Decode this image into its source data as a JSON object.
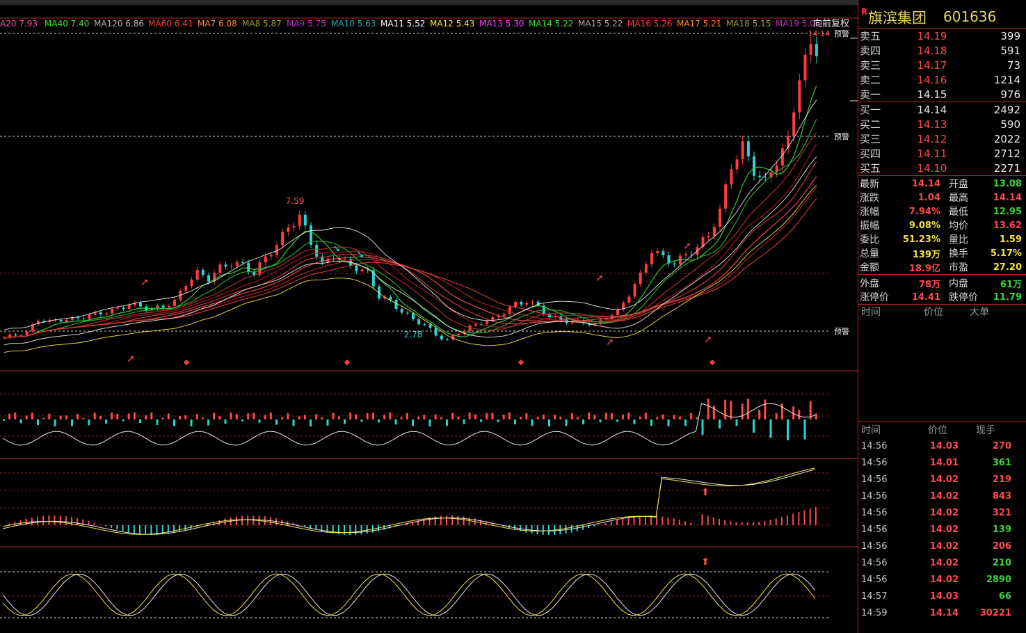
{
  "chart": {
    "ma_legend": [
      {
        "label": "A20 7.93",
        "color": "#ff4fa8"
      },
      {
        "label": "MA40 7.40",
        "color": "#39e23a"
      },
      {
        "label": "MA120 6.86",
        "color": "#b5b5b5"
      },
      {
        "label": "MA60 6.41",
        "color": "#ff3c3c"
      },
      {
        "label": "MA7 6.08",
        "color": "#ff8c2e"
      },
      {
        "label": "MA8 5.87",
        "color": "#9a9a3a"
      },
      {
        "label": "MA9 5.75",
        "color": "#c030c0"
      },
      {
        "label": "MA10 5.63",
        "color": "#2aa6a6"
      },
      {
        "label": "MA11 5.52",
        "color": "#ffffff"
      },
      {
        "label": "MA12 5.43",
        "color": "#f4e542"
      },
      {
        "label": "MA13 5.30",
        "color": "#ff3cff"
      },
      {
        "label": "MA14 5.22",
        "color": "#39e23a"
      },
      {
        "label": "MA15 5.22",
        "color": "#a8a8a8"
      },
      {
        "label": "MA16 5.26",
        "color": "#ff3c3c"
      },
      {
        "label": "MA17 5.21",
        "color": "#ff8c2e"
      },
      {
        "label": "MA18 5.15",
        "color": "#9a9a3a"
      },
      {
        "label": "MA19 5.06",
        "color": "#c030c0"
      }
    ],
    "adjust_mode": "向前复权",
    "price_high_label": "14.14",
    "peak_label": "7.59",
    "trough_label": "2.78",
    "alert_labels": [
      "预警",
      "预警",
      "预警"
    ]
  },
  "stock": {
    "flag": "R",
    "name": "旗滨集团",
    "code": "601636"
  },
  "order_book": {
    "asks": [
      {
        "label": "卖五",
        "price": "14.19",
        "vol": "399"
      },
      {
        "label": "卖四",
        "price": "14.18",
        "vol": "591"
      },
      {
        "label": "卖三",
        "price": "14.17",
        "vol": "73"
      },
      {
        "label": "卖二",
        "price": "14.16",
        "vol": "1214"
      },
      {
        "label": "卖一",
        "price": "14.15",
        "vol": "976"
      }
    ],
    "bids": [
      {
        "label": "买一",
        "price": "14.14",
        "vol": "2492"
      },
      {
        "label": "买二",
        "price": "14.13",
        "vol": "590"
      },
      {
        "label": "买三",
        "price": "14.12",
        "vol": "2022"
      },
      {
        "label": "买四",
        "price": "14.11",
        "vol": "2712"
      },
      {
        "label": "买五",
        "price": "14.10",
        "vol": "2271"
      }
    ]
  },
  "stats": [
    {
      "k": "最新",
      "v": "14.14",
      "vc": "red",
      "k2": "开盘",
      "v2": "13.08",
      "v2c": "green"
    },
    {
      "k": "涨跌",
      "v": "1.04",
      "vc": "red",
      "k2": "最高",
      "v2": "14.14",
      "v2c": "red"
    },
    {
      "k": "涨幅",
      "v": "7.94%",
      "vc": "red",
      "k2": "最低",
      "v2": "12.95",
      "v2c": "green"
    },
    {
      "k": "振幅",
      "v": "9.08%",
      "vc": "yellow",
      "k2": "均价",
      "v2": "13.62",
      "v2c": "red"
    },
    {
      "k": "委比",
      "v": "51.23%",
      "vc": "yellow",
      "k2": "量比",
      "v2": "1.59",
      "v2c": "yellow"
    },
    {
      "k": "总量",
      "v": "139万",
      "vc": "yellow",
      "k2": "换手",
      "v2": "5.17%",
      "v2c": "yellow"
    },
    {
      "k": "金额",
      "v": "18.9亿",
      "vc": "red",
      "k2": "市盈",
      "v2": "27.20",
      "v2c": "yellow"
    }
  ],
  "ext": [
    {
      "k": "外盘",
      "v": "78万",
      "vc": "red",
      "k2": "内盘",
      "v2": "61万",
      "v2c": "green"
    },
    {
      "k": "涨停价",
      "v": "14.41",
      "vc": "red",
      "k2": "跌停价",
      "v2": "11.79",
      "v2c": "green"
    }
  ],
  "big_order_header": [
    "时间",
    "价位",
    "大单"
  ],
  "tick_header": [
    "时间",
    "价位",
    "现手"
  ],
  "ticks": [
    {
      "t": "14:56",
      "p": "14.03",
      "v": "270",
      "vc": "red"
    },
    {
      "t": "14:56",
      "p": "14.01",
      "v": "361",
      "vc": "green"
    },
    {
      "t": "14:56",
      "p": "14.02",
      "v": "219",
      "vc": "red"
    },
    {
      "t": "14:56",
      "p": "14.02",
      "v": "843",
      "vc": "red"
    },
    {
      "t": "14:56",
      "p": "14.02",
      "v": "321",
      "vc": "red"
    },
    {
      "t": "14:56",
      "p": "14.02",
      "v": "139",
      "vc": "green"
    },
    {
      "t": "14:56",
      "p": "14.02",
      "v": "206",
      "vc": "red"
    },
    {
      "t": "14:56",
      "p": "14.02",
      "v": "210",
      "vc": "green"
    },
    {
      "t": "14:56",
      "p": "14.02",
      "v": "2890",
      "vc": "green"
    },
    {
      "t": "14:57",
      "p": "14.03",
      "v": "66",
      "vc": "green"
    },
    {
      "t": "14:59",
      "p": "14.14",
      "v": "30221",
      "vc": "red"
    }
  ],
  "chart_data": {
    "type": "candlestick",
    "ylim": [
      2.5,
      14.6
    ],
    "closes": [
      2.9,
      3.0,
      3.1,
      3.6,
      3.5,
      3.6,
      3.6,
      3.7,
      3.8,
      3.9,
      4.0,
      4.2,
      4.1,
      4.0,
      4.1,
      4.3,
      5.0,
      5.4,
      5.2,
      5.6,
      5.8,
      5.7,
      5.4,
      6.0,
      6.5,
      7.2,
      7.59,
      6.6,
      5.7,
      6.1,
      5.8,
      5.6,
      5.4,
      4.5,
      4.3,
      3.9,
      3.6,
      3.4,
      3.0,
      2.78,
      3.1,
      3.3,
      3.5,
      3.6,
      3.9,
      4.2,
      4.3,
      4.1,
      3.7,
      3.6,
      3.5,
      3.5,
      3.4,
      3.7,
      3.9,
      4.6,
      5.3,
      6.3,
      6.0,
      5.8,
      6.1,
      6.4,
      6.9,
      7.8,
      9.6,
      10.3,
      9.4,
      8.9,
      9.8,
      10.5,
      13.1,
      14.14
    ]
  }
}
